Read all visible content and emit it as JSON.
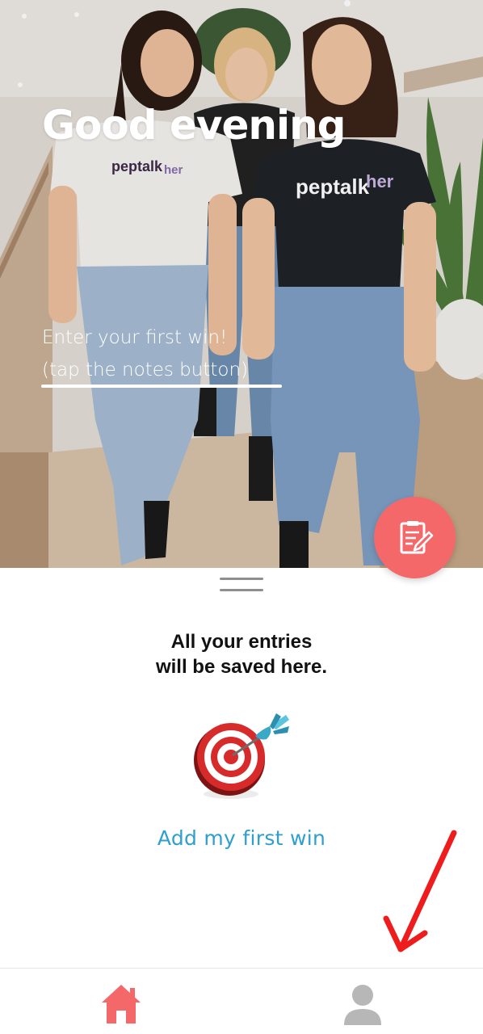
{
  "hero": {
    "greeting": "Good evening",
    "hint_line1": "Enter your first win!",
    "hint_line2": "(tap the notes button)",
    "shirt_brand": "peptalkher"
  },
  "fab": {
    "icon": "notes-icon",
    "color": "#f4686a"
  },
  "sheet": {
    "empty_title_line1": "All your entries",
    "empty_title_line2": "will be saved here.",
    "empty_icon": "target-dart-icon",
    "add_link": "Add my first win",
    "link_color": "#2e9fce"
  },
  "nav": {
    "items": [
      {
        "icon": "home-icon",
        "active": true,
        "color": "#f4686a"
      },
      {
        "icon": "profile-icon",
        "active": false,
        "color": "#b7b7b7"
      }
    ]
  },
  "annotation": {
    "icon": "red-arrow-icon",
    "color": "#ee1c1c"
  }
}
